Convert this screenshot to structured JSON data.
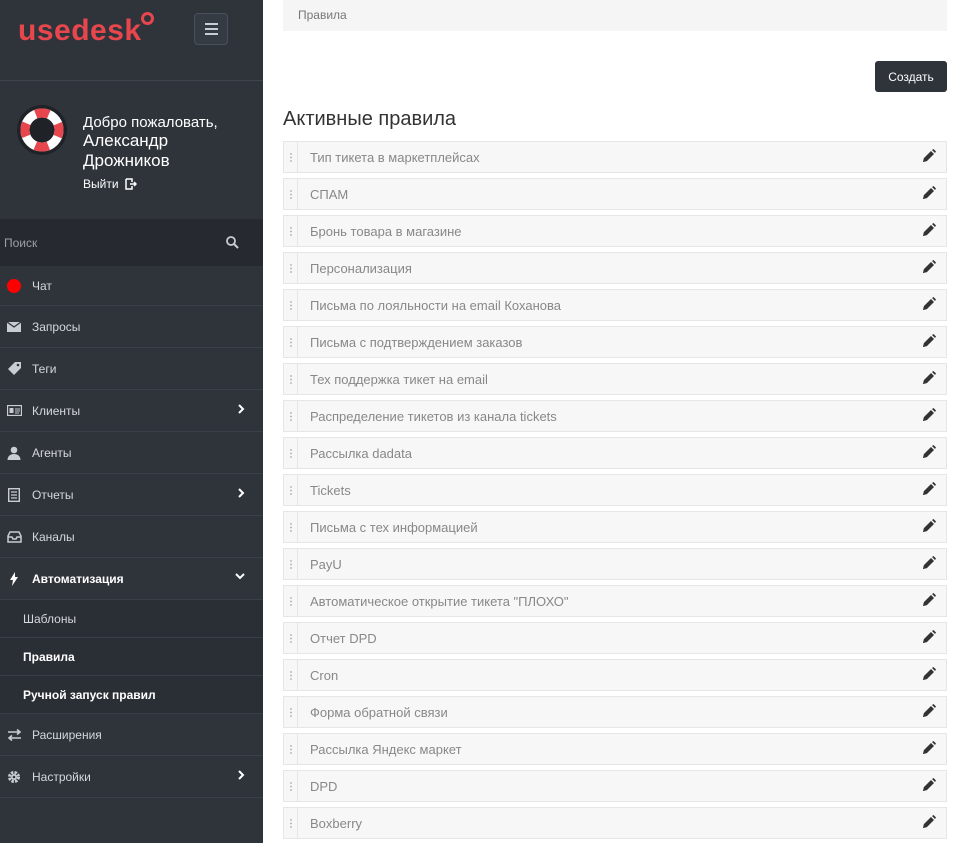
{
  "app": {
    "logo": "usedesk"
  },
  "profile": {
    "welcome": "Добро пожаловать,",
    "name": "Александр Дрожников",
    "logout": "Выйти"
  },
  "search": {
    "placeholder": "Поиск"
  },
  "nav": {
    "chat": "Чат",
    "requests": "Запросы",
    "tags": "Теги",
    "clients": "Клиенты",
    "agents": "Агенты",
    "reports": "Отчеты",
    "channels": "Каналы",
    "automation": "Автоматизация",
    "sub": {
      "templates": "Шаблоны",
      "rules": "Правила",
      "manual": "Ручной запуск правил"
    },
    "extensions": "Расширения",
    "settings": "Настройки"
  },
  "main": {
    "breadcrumb": "Правила",
    "create_label": "Создать",
    "section_title": "Активные правила",
    "rules": [
      "Тип тикета в маркетплейсах",
      "СПАМ",
      "Бронь товара в магазине",
      "Персонализация",
      "Письма по лояльности на email Коханова",
      "Письма с подтверждением заказов",
      "Тех поддержка тикет на email",
      "Распределение тикетов из канала tickets",
      "Рассылка dadata",
      "Tickets",
      "Письма с тех информацией",
      "PayU",
      "Автоматическое открытие тикета \"ПЛОХО\"",
      "Отчет DPD",
      "Cron",
      "Форма обратной связи",
      "Рассылка Яндекс маркет",
      "DPD",
      "Boxberry"
    ]
  },
  "colors": {
    "brand": "#e8464d",
    "sidebar": "#2f343b",
    "chat_status": "#ff0000"
  }
}
